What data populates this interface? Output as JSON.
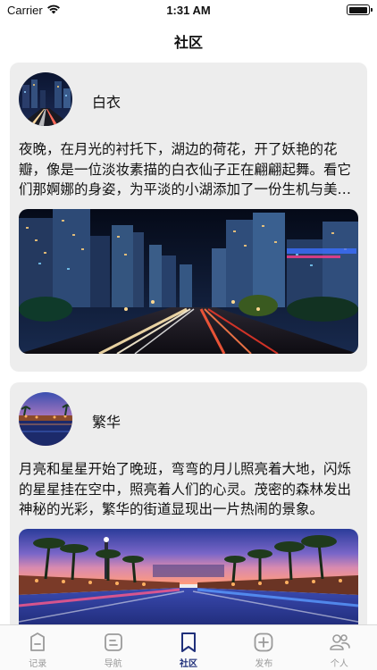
{
  "status": {
    "carrier": "Carrier",
    "time": "1:31 AM"
  },
  "nav": {
    "title": "社区"
  },
  "posts": [
    {
      "author": "白衣",
      "content": "夜晚，在月光的衬托下，湖边的荷花，开了妖艳的花瓣，像是一位淡妆素描的白衣仙子正在翩翩起舞。看它们那婀娜的身姿，为平淡的小湖添加了一份生机与美丽。"
    },
    {
      "author": "繁华",
      "content": "月亮和星星开始了晚班，弯弯的月儿照亮着大地，闪烁的星星挂在空中，照亮着人们的心灵。茂密的森林发出神秘的光彩，繁华的街道显现出一片热闹的景象。"
    }
  ],
  "tabs": [
    {
      "label": "记录",
      "icon": "record-icon"
    },
    {
      "label": "导航",
      "icon": "navigation-icon"
    },
    {
      "label": "社区",
      "icon": "bookmark-icon",
      "active": true
    },
    {
      "label": "发布",
      "icon": "plus-icon"
    },
    {
      "label": "个人",
      "icon": "people-icon"
    }
  ],
  "colors": {
    "accent": "#1f2f7a",
    "card_bg": "#ededed",
    "tab_inactive": "#9a9a9a"
  }
}
